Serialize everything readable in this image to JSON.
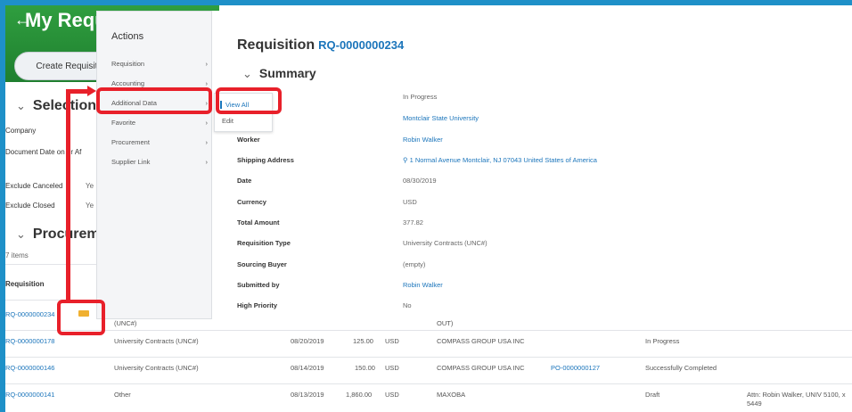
{
  "background_page": {
    "back_arrow": "←",
    "title": "My Requ",
    "create_button": "Create Requisiti",
    "selection_section": "Selection C",
    "filters": [
      {
        "label": "Company",
        "value": ""
      },
      {
        "label": "Document Date on or Af",
        "value": ""
      },
      {
        "label": "Exclude Canceled",
        "value": "Ye"
      },
      {
        "label": "Exclude Closed",
        "value": "Ye"
      }
    ],
    "procurement_section": "Procureme",
    "item_count": "7 items",
    "table_header": "Requisition",
    "rows": [
      {
        "req": "RQ-0000000234",
        "type": "(UNC#)",
        "date": "",
        "amount": "",
        "currency": "",
        "supplier": "OUT)",
        "po": "",
        "status": "",
        "memo": ""
      },
      {
        "req": "RQ-0000000178",
        "type": "University Contracts (UNC#)",
        "date": "08/20/2019",
        "amount": "125.00",
        "currency": "USD",
        "supplier": "COMPASS GROUP USA INC",
        "po": "",
        "status": "In Progress",
        "memo": ""
      },
      {
        "req": "RQ-0000000146",
        "type": "University Contracts (UNC#)",
        "date": "08/14/2019",
        "amount": "150.00",
        "currency": "USD",
        "supplier": "COMPASS GROUP USA INC",
        "po": "PO-0000000127",
        "status": "Successfully Completed",
        "memo": ""
      },
      {
        "req": "RQ-0000000141",
        "type": "Other",
        "date": "08/13/2019",
        "amount": "1,860.00",
        "currency": "USD",
        "supplier": "MAXOBA",
        "po": "",
        "status": "Draft",
        "memo": "Attn: Robin Walker, UNIV 5100, x 5449"
      }
    ]
  },
  "actions_menu": {
    "title": "Actions",
    "items": [
      {
        "label": "Requisition",
        "chevron": "›"
      },
      {
        "label": "Accounting",
        "chevron": "›"
      },
      {
        "label": "Additional Data",
        "chevron": "›"
      },
      {
        "label": "Favorite",
        "chevron": "›"
      },
      {
        "label": "Procurement",
        "chevron": "›"
      },
      {
        "label": "Supplier Link",
        "chevron": "›"
      }
    ],
    "submenu": {
      "view_all": "View All",
      "edit": "Edit"
    }
  },
  "requisition": {
    "heading": "Requisition",
    "id": "RQ-0000000234",
    "summary_heading": "Summary",
    "summary_chevron": "⌄",
    "fields": [
      {
        "label": "",
        "value": "In Progress",
        "link": false
      },
      {
        "label": "",
        "value": "Montclair State University",
        "link": true
      },
      {
        "label": "Worker",
        "value": "Robin Walker",
        "link": true
      },
      {
        "label": "Shipping Address",
        "value": "⚲ 1 Normal Avenue Montclair, NJ 07043 United States of America",
        "link": true
      },
      {
        "label": "Date",
        "value": "08/30/2019",
        "link": false
      },
      {
        "label": "Currency",
        "value": "USD",
        "link": false
      },
      {
        "label": "Total Amount",
        "value": "377.82",
        "link": false
      },
      {
        "label": "Requisition Type",
        "value": "University Contracts (UNC#)",
        "link": false
      },
      {
        "label": "Sourcing Buyer",
        "value": "(empty)",
        "link": false
      },
      {
        "label": "Submitted by",
        "value": "Robin Walker",
        "link": true
      },
      {
        "label": "High Priority",
        "value": "No",
        "link": false
      }
    ]
  },
  "colors": {
    "accent": "#1b75bb",
    "annotation_red": "#e8202a",
    "header_green": "#2f9e3f",
    "frame_blue": "#1e90c8"
  }
}
